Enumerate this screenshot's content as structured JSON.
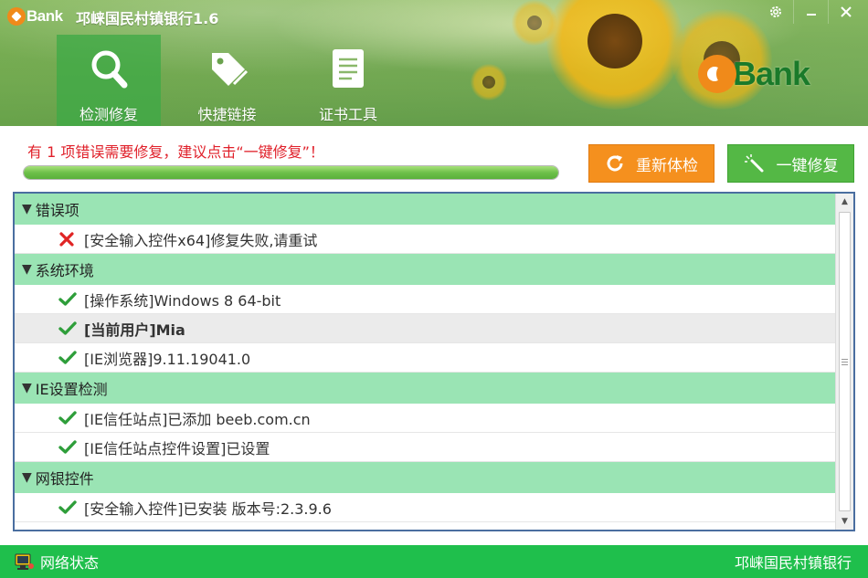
{
  "window": {
    "logo_text": "Bank",
    "title": "邛崃国民村镇银行1.6",
    "controls": [
      "settings",
      "minimize",
      "close"
    ]
  },
  "nav": {
    "items": [
      {
        "label": "检测修复",
        "icon": "magnifier-icon",
        "active": true
      },
      {
        "label": "快捷链接",
        "icon": "tag-icon",
        "active": false
      },
      {
        "label": "证书工具",
        "icon": "document-icon",
        "active": false
      }
    ]
  },
  "brand": {
    "logo_text": "Bank"
  },
  "status": {
    "message": "有 1 项错误需要修复，建议点击“一键修复”！",
    "progress": 1.0
  },
  "buttons": {
    "recheck_label": "重新体检",
    "repair_label": "一键修复"
  },
  "groups": [
    {
      "title": "错误项",
      "items": [
        {
          "status": "error",
          "text": "[安全输入控件x64]修复失败,请重试"
        }
      ]
    },
    {
      "title": "系统环境",
      "items": [
        {
          "status": "ok",
          "text": "[操作系统]Windows 8 64-bit"
        },
        {
          "status": "ok",
          "text": "[当前用户]Mia",
          "selected": true
        },
        {
          "status": "ok",
          "text": "[IE浏览器]9.11.19041.0"
        }
      ]
    },
    {
      "title": "IE设置检测",
      "items": [
        {
          "status": "ok",
          "text": "[IE信任站点]已添加 beeb.com.cn"
        },
        {
          "status": "ok",
          "text": "[IE信任站点控件设置]已设置"
        }
      ]
    },
    {
      "title": "网银控件",
      "items": [
        {
          "status": "ok",
          "text": "[安全输入控件]已安装 版本号:2.3.9.6"
        }
      ]
    }
  ],
  "footer": {
    "network_label": "网络状态",
    "bank_name": "邛崃国民村镇银行"
  },
  "colors": {
    "error_text": "#e0202a",
    "recheck_button": "#f5901e",
    "repair_button": "#54b845",
    "group_row": "#9ae4b4",
    "footer": "#1fbf4c",
    "check": "#2e9e3a",
    "cross": "#e02424"
  }
}
